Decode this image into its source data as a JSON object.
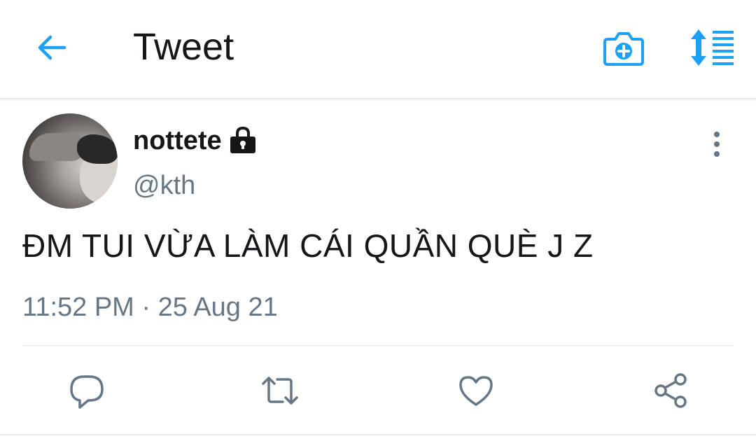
{
  "header": {
    "title": "Tweet",
    "back_icon": "arrow-left-icon",
    "camera_icon": "camera-plus-icon",
    "sort_icon": "sort-updown-icon"
  },
  "tweet": {
    "display_name": "nottete",
    "protected_icon": "lock-icon",
    "handle": "@kth",
    "text": "ĐM TUI VỪA LÀM CÁI QUẦN QUÈ J Z",
    "timestamp": "11:52 PM · 25 Aug 21",
    "more_icon": "vertical-ellipsis-icon"
  },
  "actions": {
    "reply_icon": "reply-icon",
    "retweet_icon": "retweet-icon",
    "like_icon": "heart-icon",
    "share_icon": "share-icon"
  },
  "colors": {
    "accent": "#1da1f2",
    "text_primary": "#14171a",
    "text_secondary": "#657786",
    "icon_gray": "#657786"
  }
}
